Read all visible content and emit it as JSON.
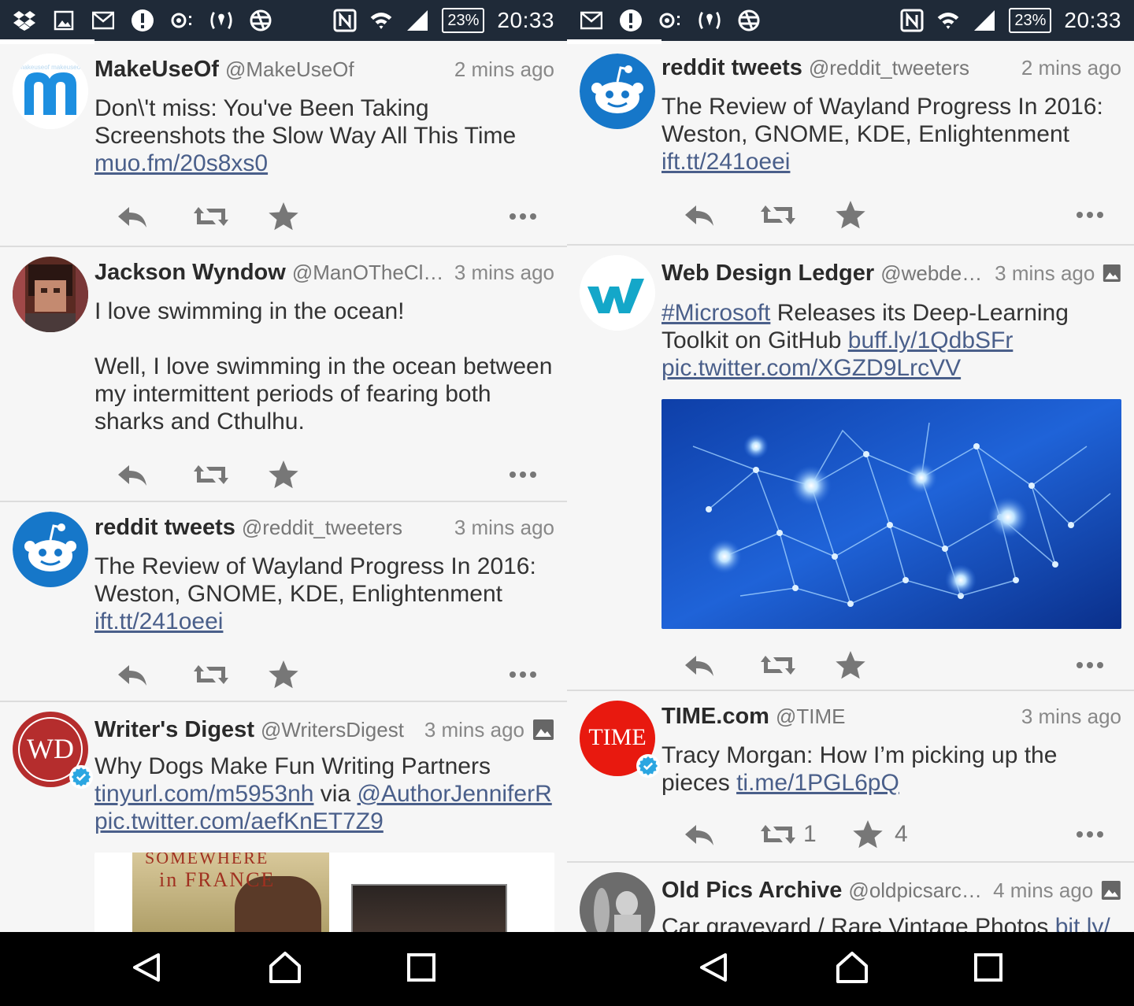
{
  "colors": {
    "status_bar": "#1f2a38",
    "link": "#4a5f8a",
    "reddit_blue": "#1677c9",
    "time_red": "#e8190f",
    "wd_red": "#b52d2d",
    "verified": "#2ba6e1"
  },
  "status_left": {
    "battery": "23%",
    "time": "20:33",
    "icons": [
      "dropbox-icon",
      "gallery-icon",
      "mail-icon",
      "alert-icon",
      "voicemail-icon",
      "hotspot-icon",
      "vpn-icon",
      "nfc-icon",
      "wifi-icon",
      "signal-icon"
    ]
  },
  "status_right": {
    "battery": "23%",
    "time": "20:33",
    "icons": [
      "mail-icon",
      "alert-icon",
      "voicemail-icon",
      "hotspot-icon",
      "vpn-icon",
      "nfc-icon",
      "wifi-icon",
      "signal-icon"
    ]
  },
  "left_feed": [
    {
      "name": "MakeUseOf",
      "handle": "@MakeUseOf",
      "time": "2 mins ago",
      "text": "Don\\'t miss: You've Been Taking Screenshots the Slow Way All This Time ",
      "link1": "muo.fm/20s8xs0"
    },
    {
      "name": "Jackson Wyndow",
      "handle": "@ManOTheClassi…",
      "time": "3 mins ago",
      "text1": "I love swimming in the ocean!",
      "text2": "Well, I love swimming in the ocean between my intermittent periods of fearing both sharks and Cthulhu."
    },
    {
      "name": "reddit tweets",
      "handle": "@reddit_tweeters",
      "time": "3 mins ago",
      "text": "The Review of Wayland Progress In 2016: Weston, GNOME, KDE, Enlightenment ",
      "link1": "ift.tt/241oeei"
    },
    {
      "name": "Writer's Digest",
      "handle": "@WritersDigest",
      "time": "3 mins ago",
      "avatar_text": "WD",
      "text": "Why Dogs Make Fun Writing Partners ",
      "link1": "tinyurl.com/m5953nh",
      "via": " via ",
      "link2": "@AuthorJenniferR",
      "link3": "pic.twitter.com/aefKnET7Z9",
      "book_line1": "SOMEWHERE",
      "book_line2": "in FRANCE"
    }
  ],
  "right_feed": [
    {
      "name": "reddit tweets",
      "handle": "@reddit_tweeters",
      "time": "2 mins ago",
      "text": "The Review of Wayland Progress In 2016: Weston, GNOME, KDE, Enlightenment ",
      "link1": "ift.tt/241oeei"
    },
    {
      "name": "Web Design Ledger",
      "handle": "@webdesig…",
      "time": "3 mins ago",
      "hashtag": "#Microsoft",
      "text": " Releases its Deep-Learning Toolkit on GitHub  ",
      "link1": "buff.ly/1QdbSFr",
      "link2": "pic.twitter.com/XGZD9LrcVV"
    },
    {
      "name": "TIME.com",
      "handle": "@TIME",
      "time": "3 mins ago",
      "avatar_text": "TIME",
      "text": "Tracy Morgan: How I’m picking up the pieces ",
      "link1": "ti.me/1PGL6pQ",
      "retweets": "1",
      "favorites": "4"
    },
    {
      "name": "Old Pics Archive",
      "handle": "@oldpicsarchive",
      "time": "4 mins ago",
      "text": "Car graveyard / Rare Vintage Photos ",
      "link1": "bit.ly/"
    }
  ]
}
